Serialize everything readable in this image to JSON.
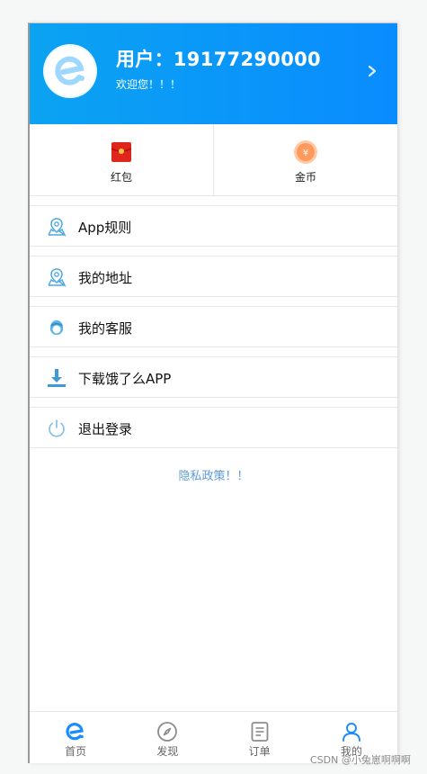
{
  "header": {
    "title": "用户：19177290000",
    "subtitle": "欢迎您！！！"
  },
  "wallet": [
    {
      "label": "红包",
      "icon": "red-envelope-icon"
    },
    {
      "label": "金币",
      "icon": "gold-coin-icon"
    }
  ],
  "menu": [
    {
      "label": "App规则",
      "icon": "map-pin-icon"
    },
    {
      "label": "我的地址",
      "icon": "map-pin-icon"
    },
    {
      "label": "我的客服",
      "icon": "customer-service-icon"
    },
    {
      "label": "下载饿了么APP",
      "icon": "download-icon"
    },
    {
      "label": "退出登录",
      "icon": "power-icon"
    }
  ],
  "privacy_link": "隐私政策！！",
  "tabbar": [
    {
      "label": "首页",
      "icon": "home-e-icon"
    },
    {
      "label": "发现",
      "icon": "compass-icon"
    },
    {
      "label": "订单",
      "icon": "order-icon"
    },
    {
      "label": "我的",
      "icon": "user-icon"
    }
  ],
  "watermark": "CSDN @小兔崽啊啊啊",
  "colors": {
    "header_start": "#0ba3f2",
    "header_end": "#0a8cff",
    "icon_blue": "#4fa8e0",
    "accent": "#1a8cff",
    "privacy": "#5b9bd5"
  }
}
